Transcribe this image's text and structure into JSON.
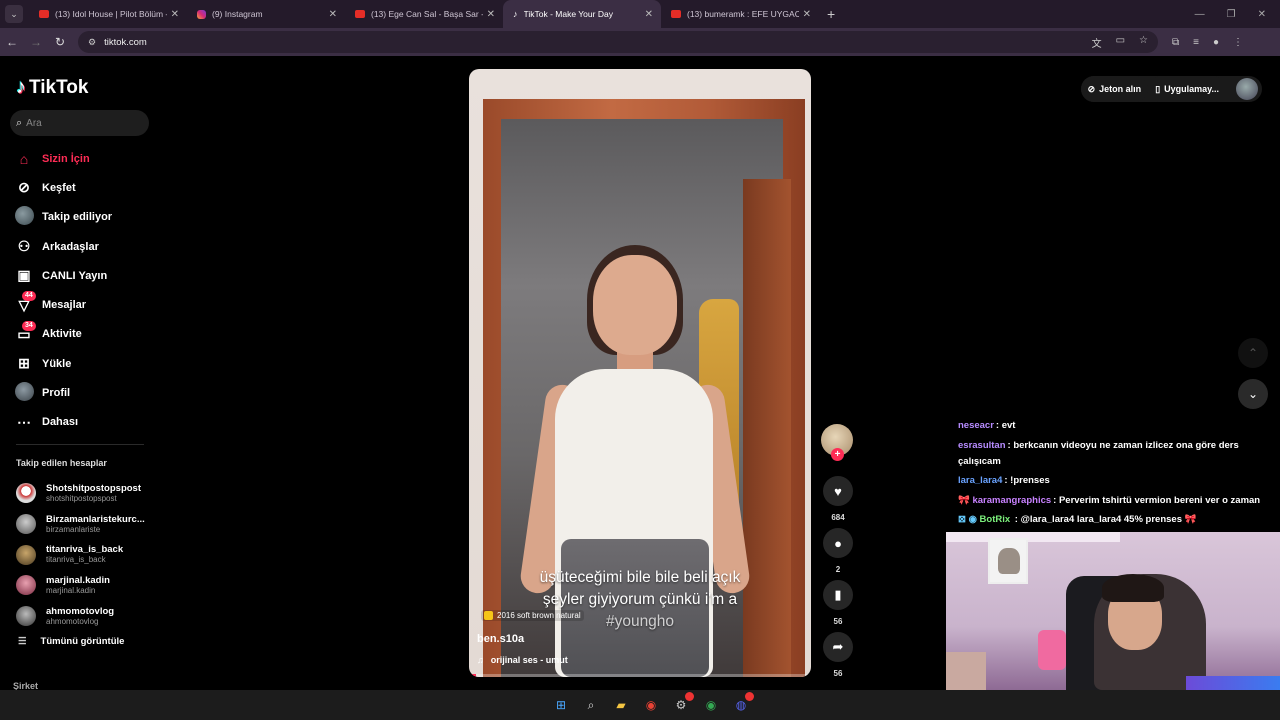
{
  "browser": {
    "tabs": [
      {
        "title": "(13) Idol House | Pilot Bölüm - Y",
        "favicon": "youtube-icon",
        "active": false
      },
      {
        "title": "(9) Instagram",
        "favicon": "instagram-icon",
        "active": false
      },
      {
        "title": "(13) Ege Can Sal - Başa Sar - Yo",
        "favicon": "youtube-icon",
        "active": false
      },
      {
        "title": "TikTok - Make Your Day",
        "favicon": "tiktok-icon",
        "active": true
      },
      {
        "title": "(13) bumeramk : EFE UYGAC AK",
        "favicon": "youtube-icon",
        "active": false
      }
    ],
    "url": "tiktok.com"
  },
  "sidebar": {
    "logo": "TikTok",
    "search_placeholder": "Ara",
    "menu": [
      {
        "label": "Sizin İçin",
        "icon": "home-icon",
        "active": true,
        "badge": ""
      },
      {
        "label": "Keşfet",
        "icon": "compass-icon",
        "active": false,
        "badge": ""
      },
      {
        "label": "Takip ediliyor",
        "icon": "following-avatar-icon",
        "active": false,
        "badge": ""
      },
      {
        "label": "Arkadaşlar",
        "icon": "friends-icon",
        "active": false,
        "badge": ""
      },
      {
        "label": "CANLI Yayın",
        "icon": "live-icon",
        "active": false,
        "badge": ""
      },
      {
        "label": "Mesajlar",
        "icon": "messages-icon",
        "active": false,
        "badge": "44"
      },
      {
        "label": "Aktivite",
        "icon": "activity-icon",
        "active": false,
        "badge": "34"
      },
      {
        "label": "Yükle",
        "icon": "upload-icon",
        "active": false,
        "badge": ""
      },
      {
        "label": "Profil",
        "icon": "profile-icon",
        "active": false,
        "badge": ""
      },
      {
        "label": "Dahası",
        "icon": "more-icon",
        "active": false,
        "badge": ""
      }
    ],
    "following_title": "Takip edilen hesaplar",
    "following": [
      {
        "name": "Shotshitpostopspost",
        "handle": "shotshitpostopspost"
      },
      {
        "name": "Birzamanlaristekurc...",
        "handle": "birzamanlariste"
      },
      {
        "name": "titanriva_is_back",
        "handle": "titanriva_is_back"
      },
      {
        "name": "marjinal.kadin",
        "handle": "marjinal.kadin"
      },
      {
        "name": "ahmomotovlog",
        "handle": "ahmomotovlog"
      }
    ],
    "see_all": "Tümünü görüntüle",
    "company": "Şirket"
  },
  "video": {
    "caption_line1": "üşüteceğimi bile bile beli açık",
    "caption_line2": "şeyler giyiyorum çünkü i'm a",
    "caption_line3": "#youngho",
    "effect": "2016 soft brown natural",
    "author": "ben.s10a",
    "sound": "orijinal ses - umut",
    "progress": 0.02
  },
  "actions": {
    "likes": "684",
    "comments": "2",
    "saves": "56",
    "shares": "56"
  },
  "topbar": {
    "coins": "Jeton alın",
    "app": "Uygulamay..."
  },
  "chat": [
    {
      "user": "neseacr",
      "color": "#b78cff",
      "message": ": evt",
      "prefix": ""
    },
    {
      "user": "esrasultan",
      "color": "#b78cff",
      "message": ": berkcanın videoyu ne zaman izlicez ona göre ders çalışıcam",
      "prefix": ""
    },
    {
      "user": "lara_lara4",
      "color": "#6aa3ff",
      "message": ": !prenses",
      "prefix": ""
    },
    {
      "user": "karamangraphics",
      "color": "#c882ff",
      "message": ": Perverim tshirtü vermion bereni ver o zaman",
      "prefix": "🎀 "
    },
    {
      "user": "BotRix",
      "color": "#7cf07c",
      "message": "@lara_lara4 lara_lara4 45% prenses 🎀",
      "prefix": "⊠ ◉ "
    }
  ],
  "colors": {
    "accent": "#fe2c55",
    "chat_mention": "#8ab4ff"
  }
}
